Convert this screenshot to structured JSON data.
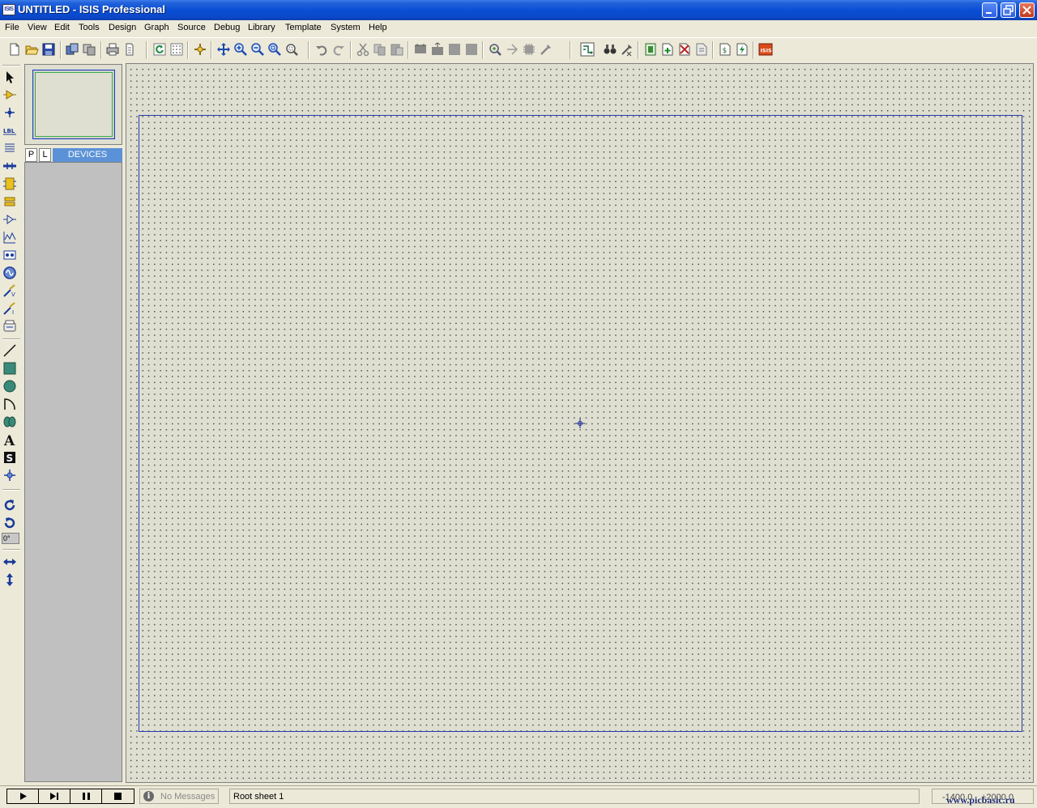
{
  "titlebar": {
    "app_icon_text": "ISIS",
    "title": "UNTITLED - ISIS Professional"
  },
  "menubar": {
    "items": [
      "File",
      "View",
      "Edit",
      "Tools",
      "Design",
      "Graph",
      "Source",
      "Debug",
      "Library",
      "Template",
      "System",
      "Help"
    ]
  },
  "toolbar": {
    "icons": [
      "new-icon",
      "open-icon",
      "save-icon",
      "import-icon",
      "export-icon",
      "print-icon",
      "print-area-icon",
      "refresh-icon",
      "grid-icon",
      "origin-icon",
      "pan-icon",
      "zoom-in-icon",
      "zoom-out-icon",
      "zoom-all-icon",
      "zoom-area-icon",
      "undo-icon",
      "redo-icon",
      "cut-icon",
      "copy-icon",
      "paste-icon",
      "block-copy-icon",
      "block-move-icon",
      "block-rotate-icon",
      "block-delete-icon",
      "pick-device-icon",
      "make-device-icon",
      "packaging-icon",
      "decompose-icon",
      "wire-autorouter-icon",
      "search-tag-icon",
      "property-assignment-icon",
      "new-sheet-icon",
      "add-sheet-icon",
      "remove-sheet-icon",
      "goto-sheet-icon",
      "bill-of-materials-icon",
      "electrical-rule-check-icon",
      "netlist-to-ares-icon"
    ]
  },
  "left_tools": {
    "icons": [
      "selection-mode-icon",
      "component-mode-icon",
      "junction-dot-icon",
      "wire-label-icon",
      "text-script-icon",
      "buses-icon",
      "subcircuit-icon",
      "terminals-icon",
      "device-pins-icon",
      "graph-icon",
      "tape-recorder-icon",
      "generator-icon",
      "voltage-probe-icon",
      "current-probe-icon",
      "virtual-instruments-icon",
      "line-icon",
      "box-icon",
      "circle-icon",
      "arc-icon",
      "closed-path-icon",
      "text-icon",
      "symbol-icon",
      "marker-icon",
      "rotate-clockwise-icon",
      "rotate-anticlockwise-icon",
      "mirror-x-icon",
      "mirror-y-icon"
    ],
    "angle_value": "0°"
  },
  "device_selector": {
    "tab_p": "P",
    "tab_l": "L",
    "label": "DEVICES"
  },
  "status": {
    "messages": "No Messages",
    "sheet": "Root sheet 1",
    "coord_x": "-1400.0",
    "coord_y": "+2000.0",
    "watermark": "www.picbasic.ru"
  },
  "colors": {
    "title_blue": "#0a4fd6",
    "canvas_bg": "#dedfd0",
    "sheet_border": "#2a3ab0",
    "devices_header": "#5b92d7"
  }
}
